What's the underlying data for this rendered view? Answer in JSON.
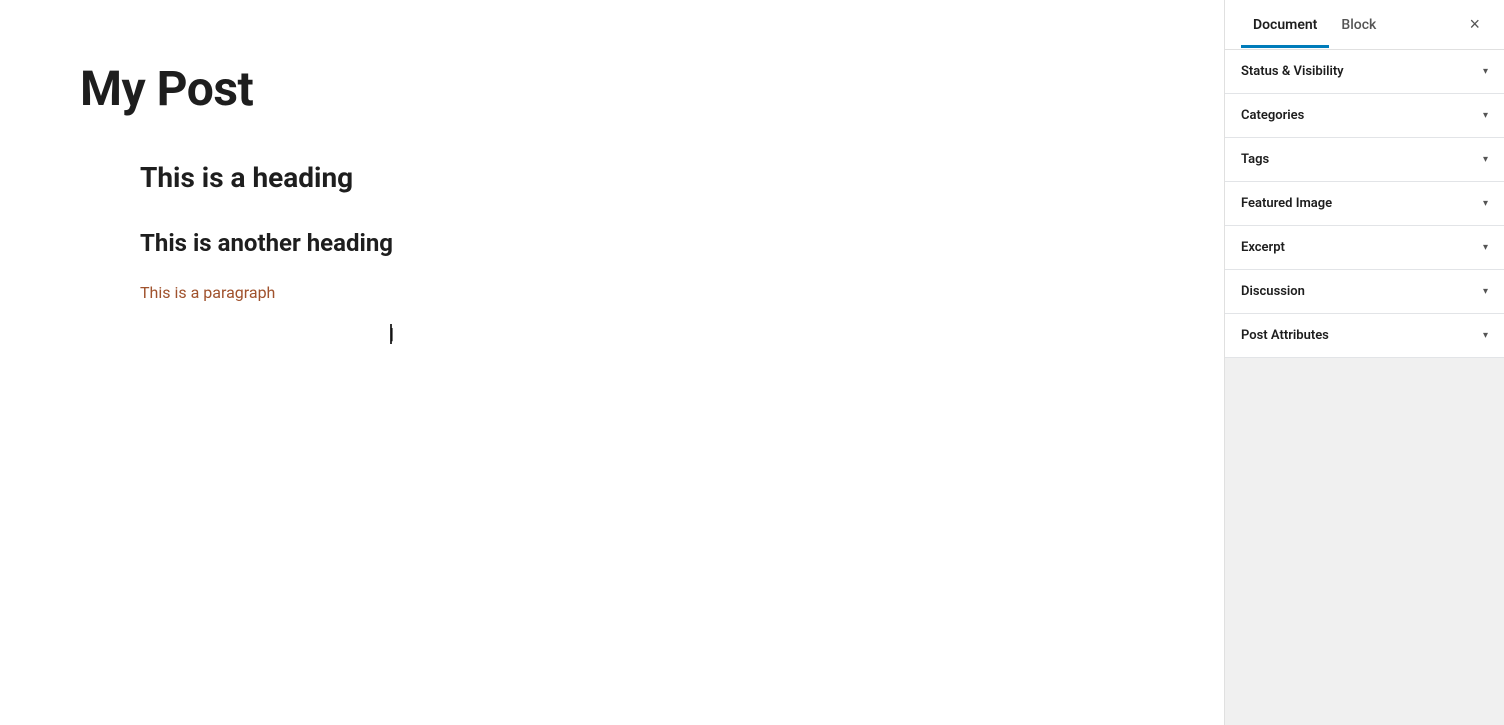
{
  "editor": {
    "post_title": "My Post",
    "heading1": "This is a heading",
    "heading2": "This is another heading",
    "paragraph": "This is a paragraph"
  },
  "sidebar": {
    "tab_document": "Document",
    "tab_block": "Block",
    "close_label": "×",
    "panels": [
      {
        "id": "status-visibility",
        "label": "Status & Visibility"
      },
      {
        "id": "categories",
        "label": "Categories"
      },
      {
        "id": "tags",
        "label": "Tags"
      },
      {
        "id": "featured-image",
        "label": "Featured Image"
      },
      {
        "id": "excerpt",
        "label": "Excerpt"
      },
      {
        "id": "discussion",
        "label": "Discussion"
      },
      {
        "id": "post-attributes",
        "label": "Post Attributes"
      }
    ]
  },
  "icons": {
    "chevron_down": "▾",
    "close": "×"
  }
}
